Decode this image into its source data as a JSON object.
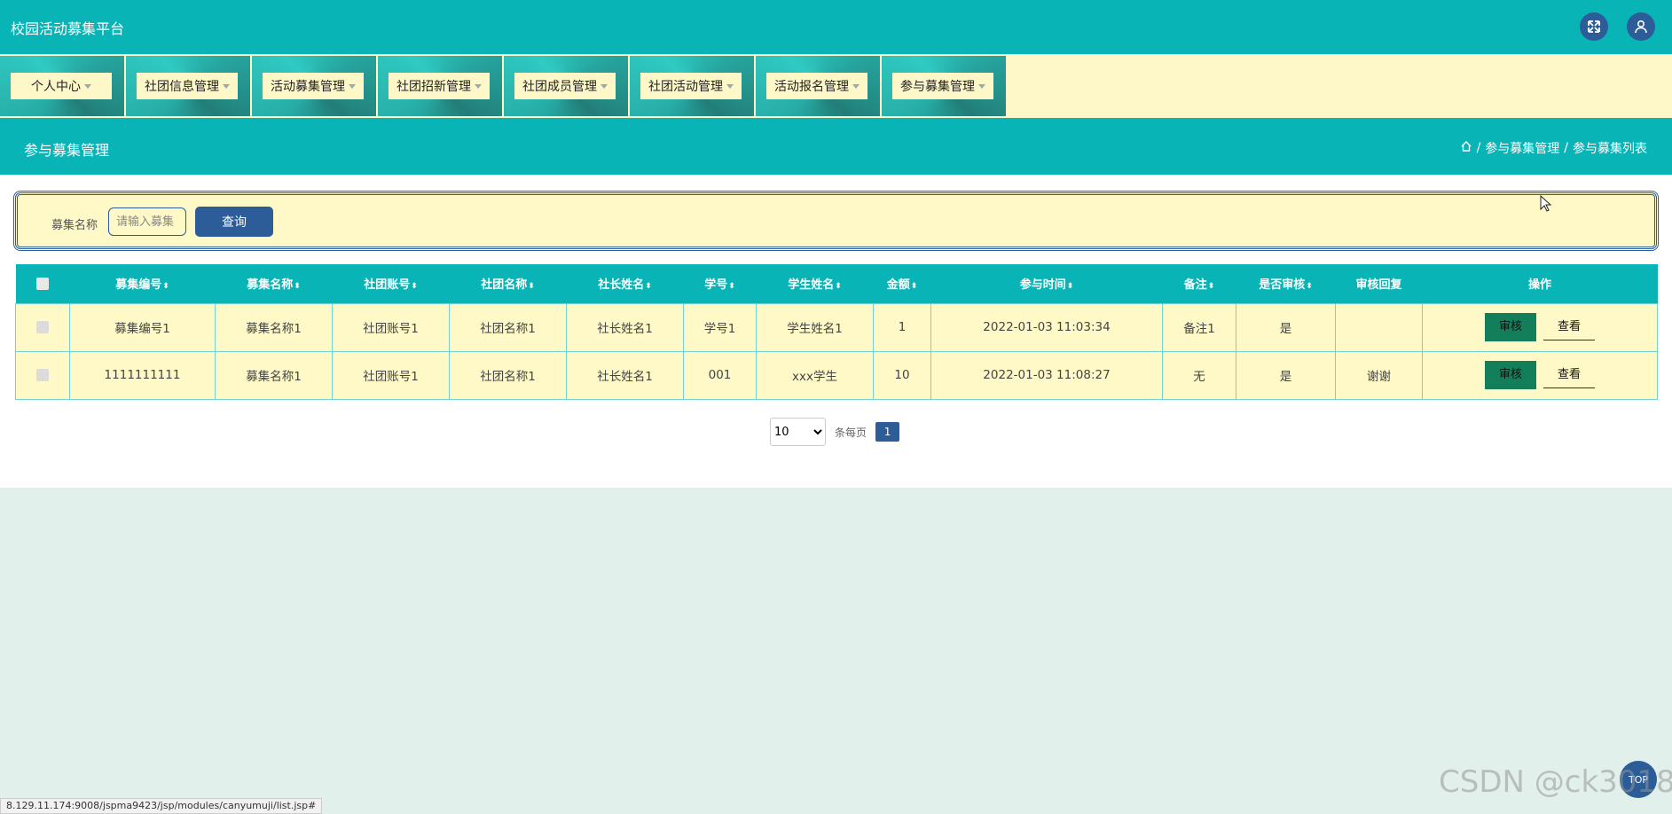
{
  "app": {
    "title": "校园活动募集平台"
  },
  "nav": {
    "items": [
      {
        "label": "个人中心"
      },
      {
        "label": "社团信息管理"
      },
      {
        "label": "活动募集管理"
      },
      {
        "label": "社团招新管理"
      },
      {
        "label": "社团成员管理"
      },
      {
        "label": "社团活动管理"
      },
      {
        "label": "活动报名管理"
      },
      {
        "label": "参与募集管理"
      }
    ]
  },
  "page": {
    "title": "参与募集管理",
    "breadcrumb": {
      "section": "参与募集管理",
      "current": "参与募集列表",
      "separator": "/"
    }
  },
  "search": {
    "label": "募集名称",
    "placeholder": "请输入募集",
    "button": "查询"
  },
  "table": {
    "headers": [
      "募集编号",
      "募集名称",
      "社团账号",
      "社团名称",
      "社长姓名",
      "学号",
      "学生姓名",
      "金额",
      "参与时间",
      "备注",
      "是否审核",
      "审核回复",
      "操作"
    ],
    "sort_glyph": "⬍",
    "rows": [
      {
        "cells": [
          "募集编号1",
          "募集名称1",
          "社团账号1",
          "社团名称1",
          "社长姓名1",
          "学号1",
          "学生姓名1",
          "1",
          "2022-01-03 11:03:34",
          "备注1",
          "是",
          ""
        ],
        "audit": "审核",
        "view": "查看"
      },
      {
        "cells": [
          "1111111111",
          "募集名称1",
          "社团账号1",
          "社团名称1",
          "社长姓名1",
          "001",
          "xxx学生",
          "10",
          "2022-01-03 11:08:27",
          "无",
          "是",
          "谢谢"
        ],
        "audit": "审核",
        "view": "查看"
      }
    ]
  },
  "pager": {
    "page_size": "10",
    "per_page_text": "条每页",
    "current_page": "1"
  },
  "status_url": "8.129.11.174:9008/jspma9423/jsp/modules/canyumuji/list.jsp#",
  "watermark": "CSDN @ck3018",
  "scroll_top": "TOP",
  "colors": {
    "teal": "#08b4b6",
    "cream": "#fef9c6",
    "navy": "#2c5d99",
    "green": "#127e5a"
  }
}
